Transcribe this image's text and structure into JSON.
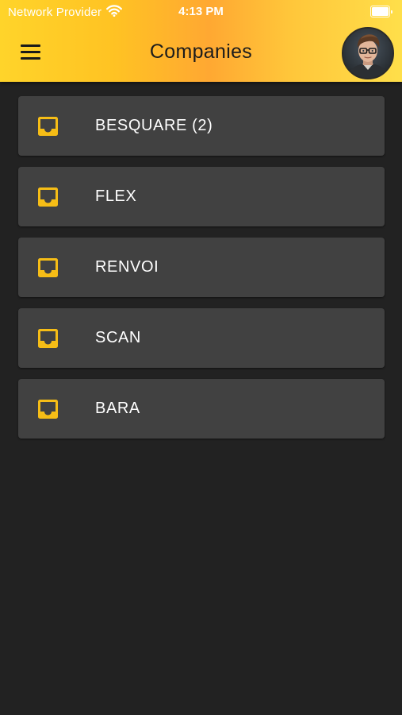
{
  "status_bar": {
    "carrier": "Network Provider",
    "time": "4:13 PM",
    "wifi_icon": "wifi-icon",
    "battery_icon": "battery-icon"
  },
  "header": {
    "title": "Companies",
    "menu_icon": "hamburger-menu-icon",
    "avatar_icon": "user-avatar"
  },
  "colors": {
    "header_gradient": [
      "#ffd42a",
      "#ffa832",
      "#ffdf4a"
    ],
    "background": "#222222",
    "card": "#414141",
    "icon_accent": "#f6bd16",
    "text": "#ffffff"
  },
  "companies": [
    {
      "label": "BESQUARE (2)",
      "icon": "inbox-icon"
    },
    {
      "label": "FLEX",
      "icon": "inbox-icon"
    },
    {
      "label": "RENVOI",
      "icon": "inbox-icon"
    },
    {
      "label": "SCAN",
      "icon": "inbox-icon"
    },
    {
      "label": "BARA",
      "icon": "inbox-icon"
    }
  ]
}
